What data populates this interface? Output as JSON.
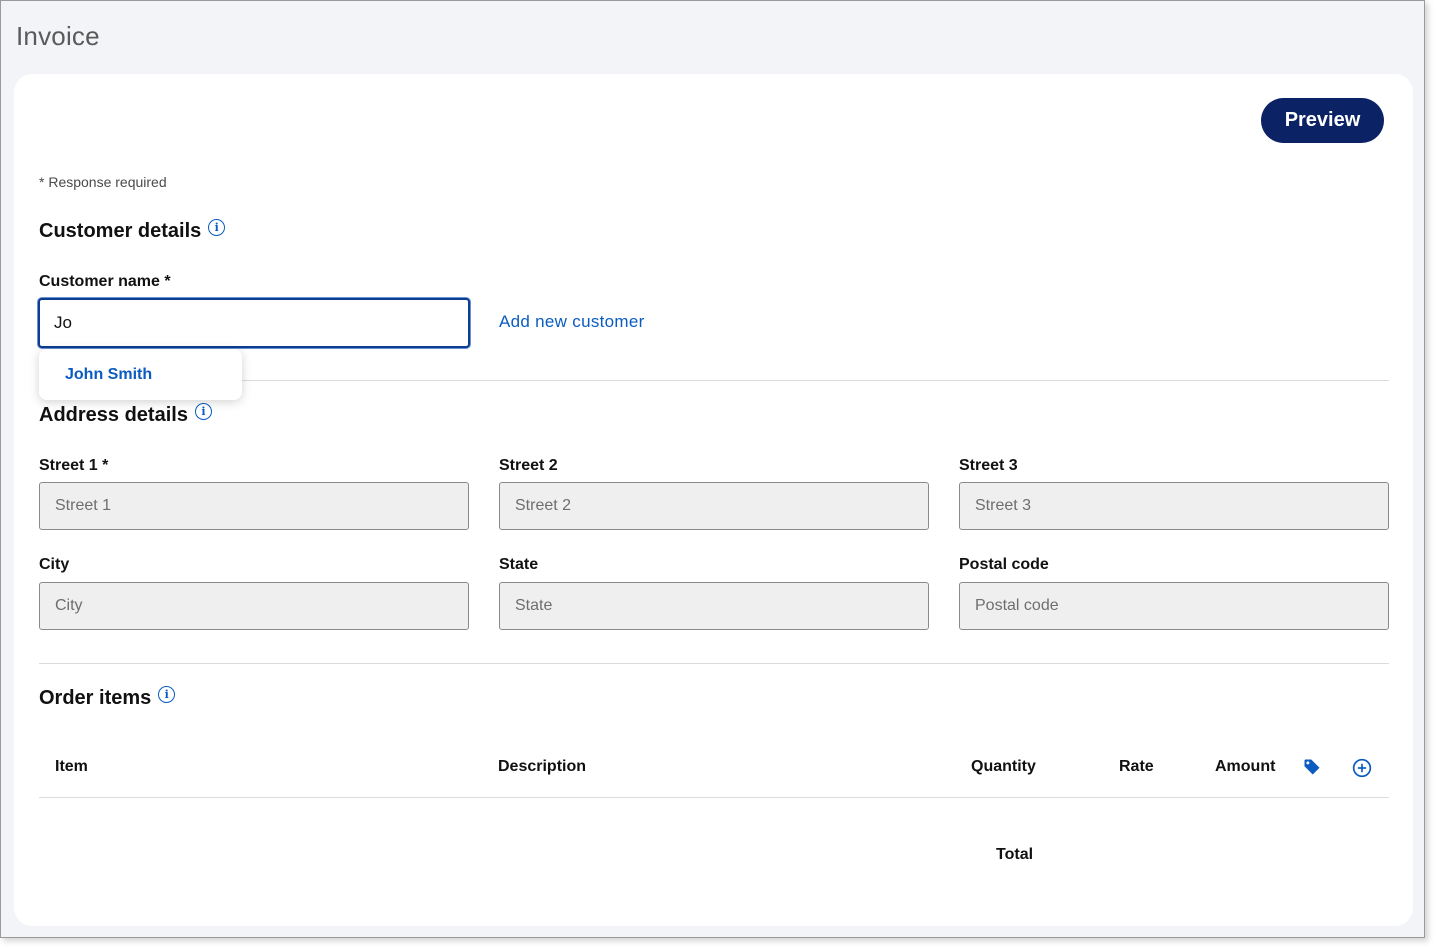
{
  "page": {
    "title": "Invoice"
  },
  "toolbar": {
    "preview_label": "Preview"
  },
  "form": {
    "required_note": "* Response required",
    "customer_section": {
      "title": "Customer details",
      "name_label": "Customer name *",
      "name_value": "Jo",
      "add_link": "Add new customer",
      "suggestions": [
        "John Smith"
      ]
    },
    "address_section": {
      "title": "Address details",
      "fields": {
        "street1": {
          "label": "Street 1 *",
          "placeholder": "Street 1",
          "value": ""
        },
        "street2": {
          "label": "Street 2",
          "placeholder": "Street 2",
          "value": ""
        },
        "street3": {
          "label": "Street 3",
          "placeholder": "Street 3",
          "value": ""
        },
        "city": {
          "label": "City",
          "placeholder": "City",
          "value": ""
        },
        "state": {
          "label": "State",
          "placeholder": "State",
          "value": ""
        },
        "postal": {
          "label": "Postal code",
          "placeholder": "Postal code",
          "value": ""
        }
      }
    },
    "order_section": {
      "title": "Order items",
      "columns": {
        "item": "Item",
        "description": "Description",
        "quantity": "Quantity",
        "rate": "Rate",
        "amount": "Amount"
      },
      "total_label": "Total"
    }
  },
  "icons": {
    "info": "info-icon",
    "tag": "tag-icon",
    "add": "add-circle-icon"
  },
  "colors": {
    "primary": "#0b2265",
    "link": "#0b5cc0",
    "background": "#f2f4f8"
  }
}
